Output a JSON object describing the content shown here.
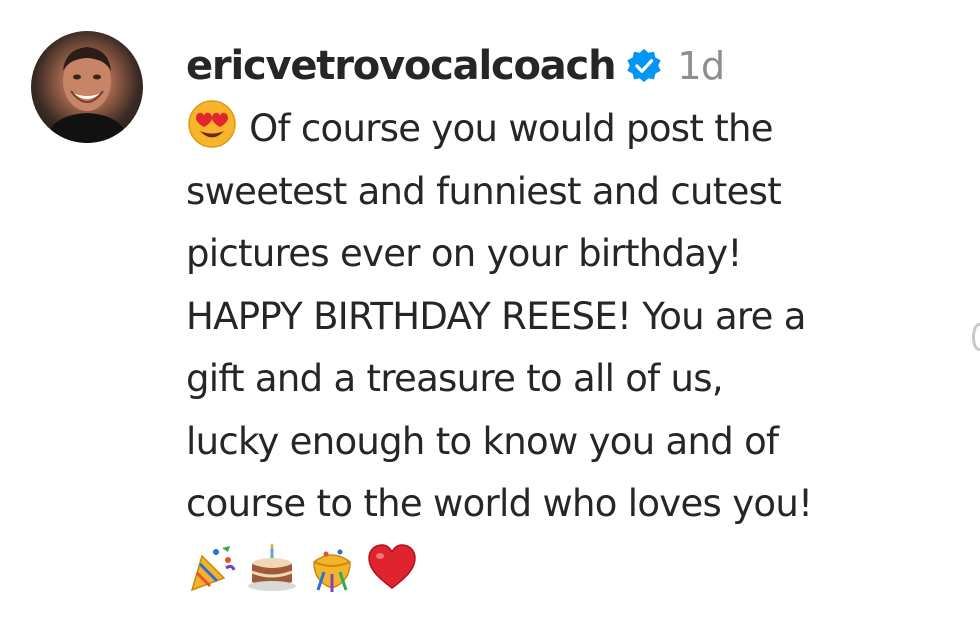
{
  "comment": {
    "username": "ericvetrovocalcoach",
    "verified": true,
    "timestamp": "1d",
    "lines": [
      "Of course you would post the",
      "sweetest and funniest and cutest",
      "pictures ever on your birthday!",
      "HAPPY BIRTHDAY REESE! You are a",
      "gift and a treasure to all of us,",
      "lucky enough to know you and of",
      "course to the world who loves you!"
    ],
    "leading_emoji": "smiling-face-with-heart-eyes-icon",
    "trailing_emojis": [
      "party-popper-icon",
      "birthday-cake-icon",
      "confetti-ball-icon",
      "red-heart-icon"
    ]
  },
  "colors": {
    "text": "#262626",
    "secondary_text": "#8e8e8e",
    "verified_badge": "#0095f6",
    "heart": "#e0242f"
  }
}
